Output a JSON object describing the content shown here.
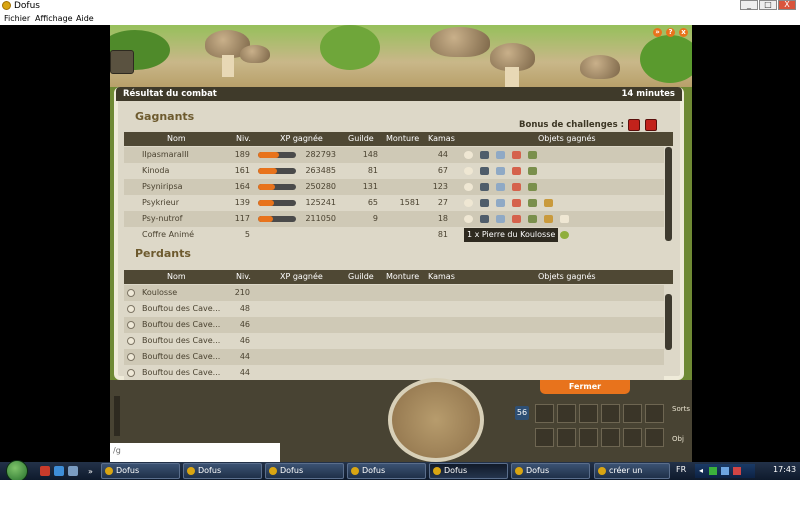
{
  "window": {
    "title": "Dofus",
    "controls": [
      "_",
      "□",
      "X"
    ]
  },
  "menu": [
    "Fichier",
    "Affichage",
    "Aide"
  ],
  "panel": {
    "title": "Résultat du combat",
    "duration": "14 minutes",
    "challenge_label": "Bonus de challenges :",
    "close_button": "Fermer"
  },
  "columns": {
    "name": "Nom",
    "level": "Niv.",
    "xp": "XP gagnée",
    "guild": "Guilde",
    "mount": "Monture",
    "kamas": "Kamas",
    "objects": "Objets gagnés"
  },
  "winners": {
    "title": "Gagnants",
    "rows": [
      {
        "name": "IIpasmaraIII",
        "level": "189",
        "xp_fill": 0.55,
        "xp": "282793",
        "guild": "148",
        "mount": "",
        "kamas": "44"
      },
      {
        "name": "Kinoda",
        "level": "161",
        "xp_fill": 0.5,
        "xp": "263485",
        "guild": "81",
        "mount": "",
        "kamas": "67"
      },
      {
        "name": "Psyniripsa",
        "level": "164",
        "xp_fill": 0.45,
        "xp": "250280",
        "guild": "131",
        "mount": "",
        "kamas": "123"
      },
      {
        "name": "Psykrieur",
        "level": "139",
        "xp_fill": 0.42,
        "xp": "125241",
        "guild": "65",
        "mount": "1581",
        "kamas": "27"
      },
      {
        "name": "Psy-nutrof",
        "level": "117",
        "xp_fill": 0.4,
        "xp": "211050",
        "guild": "9",
        "mount": "",
        "kamas": "18"
      },
      {
        "name": "Coffre Animé",
        "level": "5",
        "xp_fill": 0,
        "xp": "",
        "guild": "",
        "mount": "",
        "kamas": "81",
        "object_text": "1 x Pierre du Koulosse"
      }
    ]
  },
  "losers": {
    "title": "Perdants",
    "rows": [
      {
        "name": "Koulosse",
        "level": "210"
      },
      {
        "name": "Bouftou des Cave...",
        "level": "48"
      },
      {
        "name": "Bouftou des Cave...",
        "level": "46"
      },
      {
        "name": "Bouftou des Cave...",
        "level": "46"
      },
      {
        "name": "Bouftou des Cave...",
        "level": "44"
      },
      {
        "name": "Bouftou des Cave...",
        "level": "44"
      }
    ]
  },
  "hud": {
    "level_badge": "56",
    "sorts_tab": "Sorts",
    "objets_tab": "Obj",
    "chat_prompt": "/g"
  },
  "taskbar": {
    "items": [
      "Dofus",
      "Dofus",
      "Dofus",
      "Dofus",
      "Dofus",
      "Dofus",
      "créer un forum..."
    ],
    "active_index": 4,
    "lang": "FR",
    "clock": "17:43"
  },
  "colors": {
    "xp_bar": "#e8731c",
    "panel_header": "#3f3a2a",
    "close_button": "#e8731c",
    "challenge_icon": "#c2221b"
  }
}
